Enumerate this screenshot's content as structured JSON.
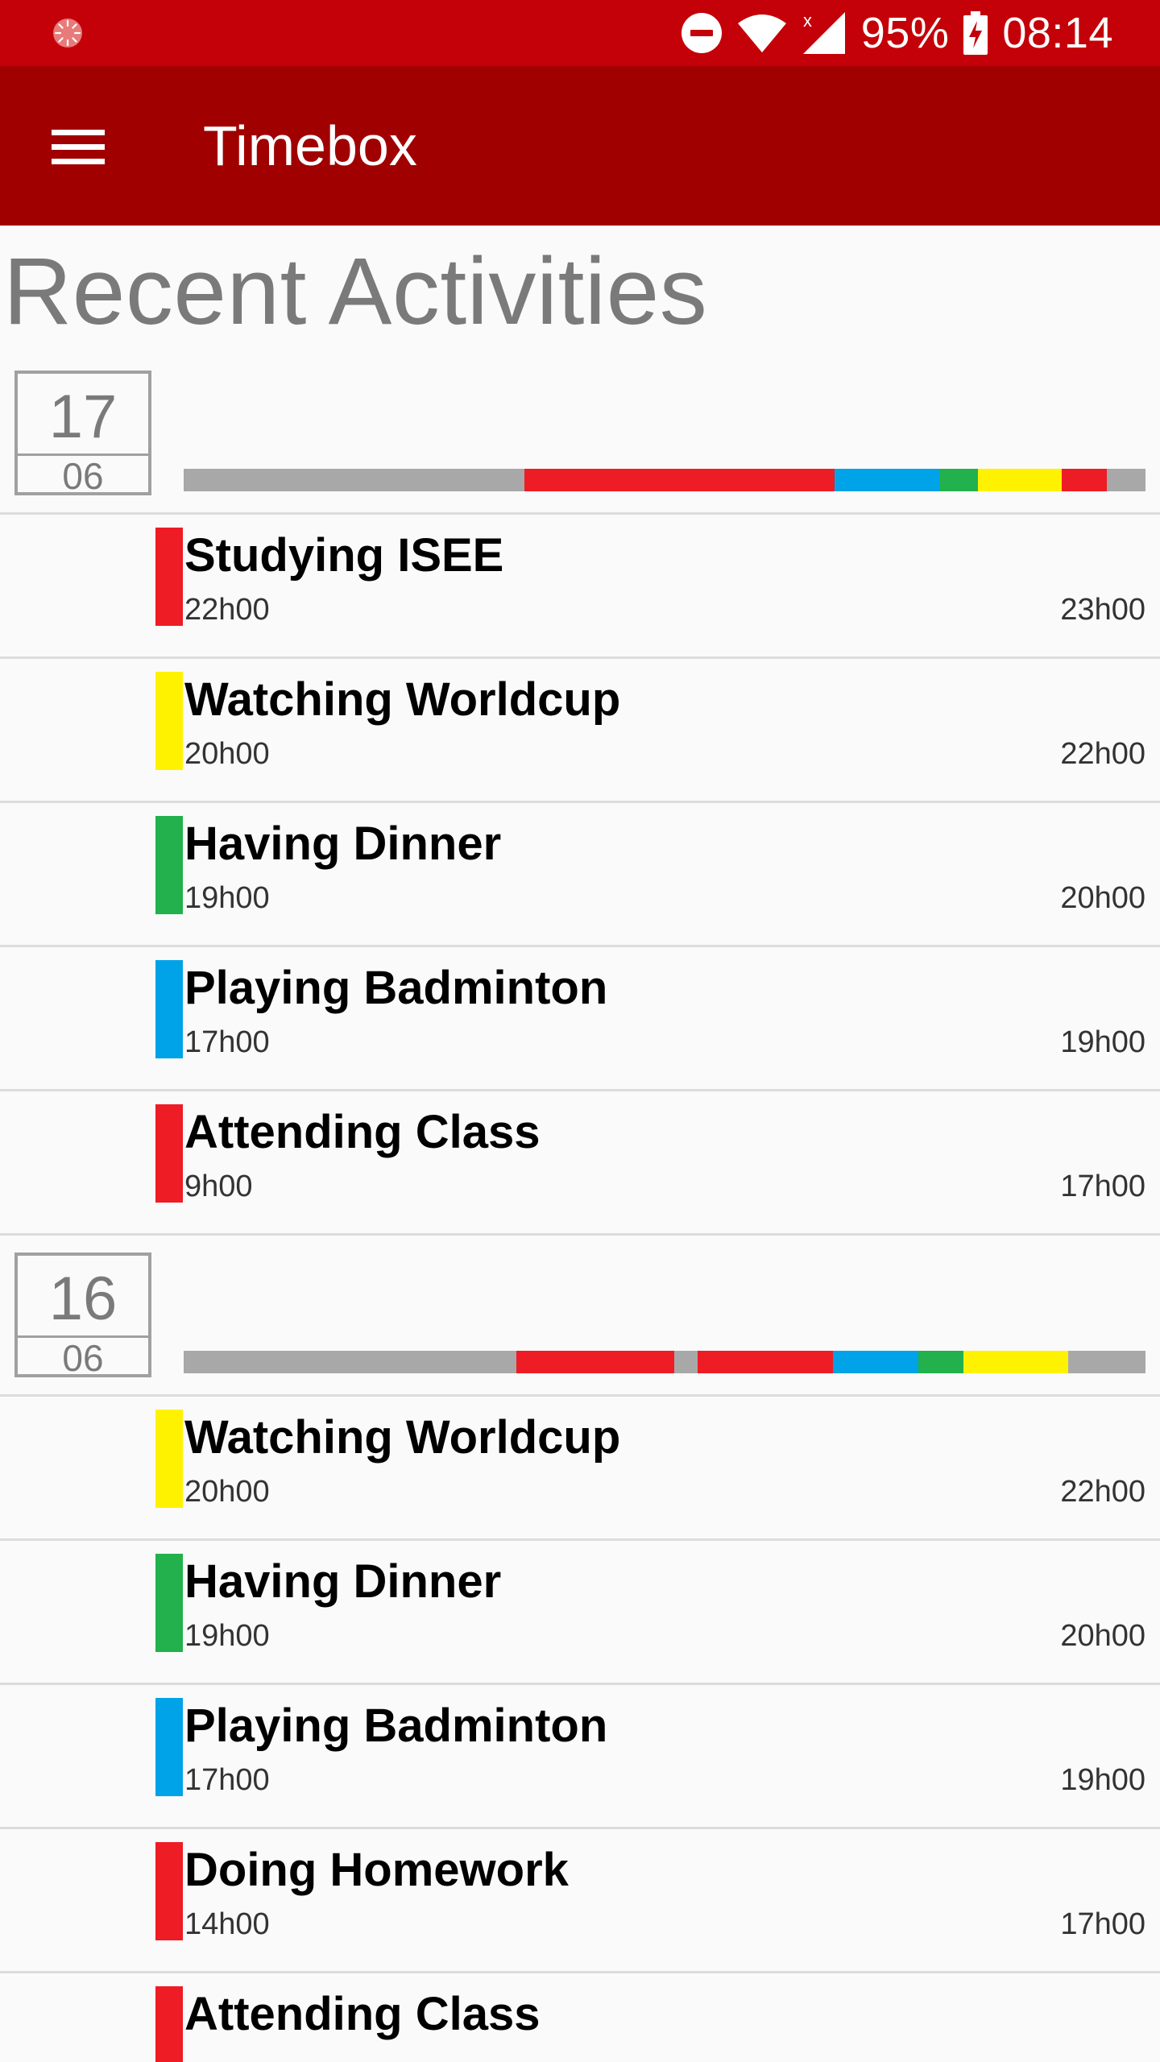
{
  "status_bar": {
    "battery_text": "95%",
    "time_text": "08:14",
    "icons": [
      "notification-spinner-icon",
      "do-not-disturb-icon",
      "wifi-icon",
      "cell-signal-icon",
      "battery-charging-icon"
    ]
  },
  "app_bar": {
    "title": "Timebox",
    "menu_icon": "hamburger-menu-icon"
  },
  "page": {
    "heading": "Recent Activities"
  },
  "colors": {
    "status_bar": "#c40008",
    "app_bar": "#a00000",
    "red": "#ee1c24",
    "yellow": "#fff200",
    "green": "#22b14c",
    "blue": "#00a2e8",
    "gray": "#a8a8a8"
  },
  "days": [
    {
      "day": "17",
      "month": "06",
      "activities": [
        {
          "name": "Studying ISEE",
          "start": "22h00",
          "end": "23h00",
          "color": "#ee1c24"
        },
        {
          "name": "Watching Worldcup",
          "start": "20h00",
          "end": "22h00",
          "color": "#fff200"
        },
        {
          "name": "Having Dinner",
          "start": "19h00",
          "end": "20h00",
          "color": "#22b14c"
        },
        {
          "name": "Playing Badminton",
          "start": "17h00",
          "end": "19h00",
          "color": "#00a2e8"
        },
        {
          "name": "Attending Class",
          "start": "9h00",
          "end": "17h00",
          "color": "#ee1c24"
        }
      ]
    },
    {
      "day": "16",
      "month": "06",
      "activities": [
        {
          "name": "Watching Worldcup",
          "start": "20h00",
          "end": "22h00",
          "color": "#fff200"
        },
        {
          "name": "Having Dinner",
          "start": "19h00",
          "end": "20h00",
          "color": "#22b14c"
        },
        {
          "name": "Playing Badminton",
          "start": "17h00",
          "end": "19h00",
          "color": "#00a2e8"
        },
        {
          "name": "Doing Homework",
          "start": "14h00",
          "end": "17h00",
          "color": "#ee1c24"
        },
        {
          "name": "Attending Class",
          "start": "",
          "end": "",
          "color": "#ee1c24"
        }
      ]
    }
  ]
}
